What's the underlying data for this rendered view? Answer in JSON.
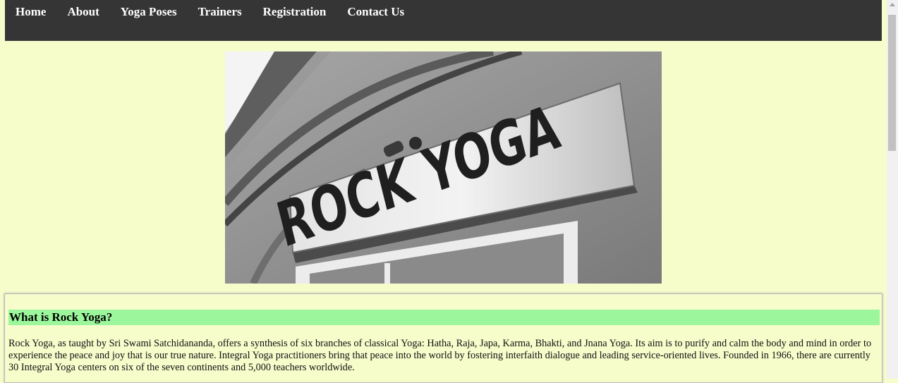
{
  "nav": {
    "items": [
      {
        "label": "Home"
      },
      {
        "label": "About"
      },
      {
        "label": "Yoga Poses"
      },
      {
        "label": "Trainers"
      },
      {
        "label": "Registration"
      },
      {
        "label": "Contact Us"
      }
    ]
  },
  "hero": {
    "sign_text": "ROCK YOGA"
  },
  "about_section": {
    "heading": "What is Rock Yoga?",
    "body": "Rock Yoga, as taught by Sri Swami Satchidananda, offers a synthesis of six branches of classical Yoga: Hatha, Raja, Japa, Karma, Bhakti, and Jnana Yoga. Its aim is to purify and calm the body and mind in order to experience the peace and joy that is our true nature. Integral Yoga practitioners bring that peace into the world by fostering interfaith dialogue and leading service-oriented lives. Founded in 1966, there are currently 30 Integral Yoga centers on six of the seven continents and 5,000 teachers worldwide."
  },
  "colors": {
    "page_background": "#f7fccb",
    "navbar_background": "#353535",
    "heading_highlight": "#9cf79c"
  }
}
